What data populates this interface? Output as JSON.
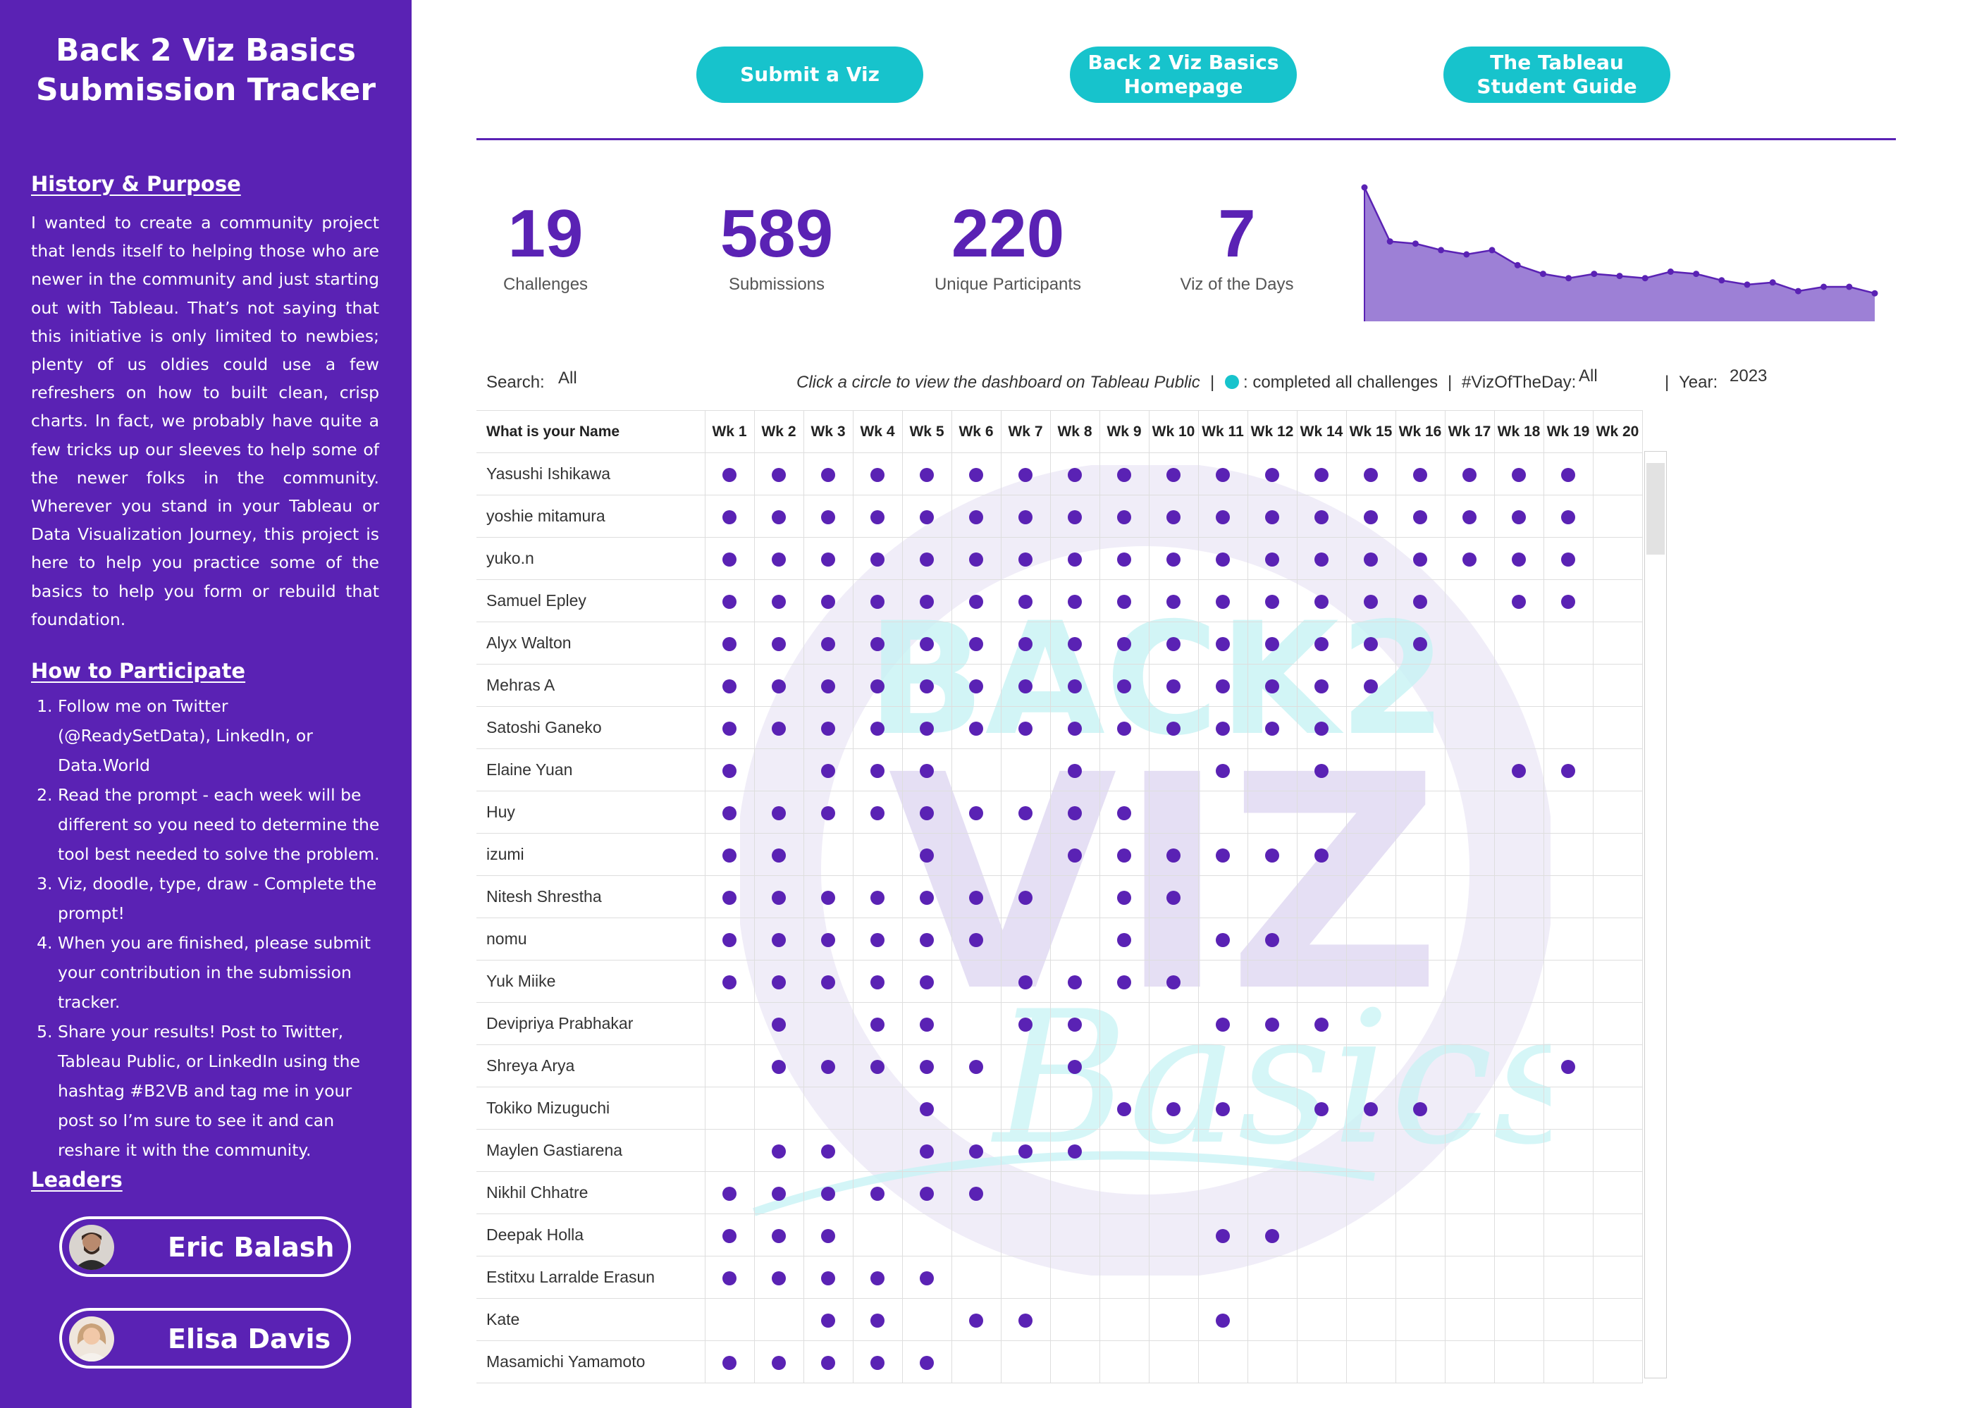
{
  "sidebar": {
    "title_line1": "Back 2 Viz Basics",
    "title_line2": "Submission Tracker",
    "history_heading": "History & Purpose",
    "history_text": "I wanted to create a community project that lends itself to helping those who are newer in the community and just starting out with Tableau. That’s not saying that this initiative is only limited to newbies; plenty of us oldies could use a few refreshers on how to built clean, crisp charts. In fact, we probably have quite a few tricks up our sleeves to help some of the newer folks in the community. Wherever you stand in your Tableau or Data Visualization Journey, this project is here to help you practice some of the basics to help you form or rebuild that foundation.",
    "participate_heading": "How to Participate",
    "steps": [
      "Follow me on Twitter (@ReadySetData), LinkedIn, or Data.World",
      "Read the prompt - each week will be different so you need to determine the tool best needed to solve the problem.",
      "Viz, doodle, type, draw - Complete the prompt!",
      "When you are finished, please submit your contribution in the submission tracker.",
      "Share your results! Post to Twitter, Tableau Public, or LinkedIn using the hashtag #B2VB and tag me in your post so I’m sure to see it and can reshare it with the community."
    ],
    "leaders_heading": "Leaders",
    "leaders": [
      "Eric Balash",
      "Elisa Davis"
    ]
  },
  "buttons": {
    "submit": "Submit a Viz",
    "homepage_line1": "Back 2 Viz Basics",
    "homepage_line2": "Homepage",
    "guide_line1": "The Tableau",
    "guide_line2": "Student Guide"
  },
  "kpis": {
    "challenges": {
      "value": "19",
      "label": "Challenges"
    },
    "submissions": {
      "value": "589",
      "label": "Submissions"
    },
    "participants": {
      "value": "220",
      "label": "Unique Participants"
    },
    "votd": {
      "value": "7",
      "label": "Viz of the Days"
    }
  },
  "sparkline": {
    "series_color": "#5a22b4",
    "fill_color": "#9d80d6",
    "values": [
      62,
      37,
      36,
      33,
      31,
      33,
      26,
      22,
      20,
      22,
      21,
      20,
      23,
      22,
      19,
      17,
      18,
      14,
      16,
      16,
      13
    ]
  },
  "filters": {
    "search_label": "Search:",
    "search_value": "All",
    "instruction": "Click a circle to view the dashboard on Tableau Public",
    "sep1": "|",
    "legend_text": ": completed all challenges",
    "sep2": "|",
    "votd_label": "#VizOfTheDay:",
    "votd_value": "All",
    "sep3": "|",
    "year_label": "Year:",
    "year_value": "2023",
    "legend_color": "#17c3cc"
  },
  "table": {
    "name_header": "What is your Name",
    "weeks": [
      "Wk 1",
      "Wk 2",
      "Wk 3",
      "Wk 4",
      "Wk 5",
      "Wk 6",
      "Wk 7",
      "Wk 8",
      "Wk 9",
      "Wk 10",
      "Wk 11",
      "Wk 12",
      "Wk 14",
      "Wk 15",
      "Wk 16",
      "Wk 17",
      "Wk 18",
      "Wk 19",
      "Wk 20"
    ],
    "rows": [
      {
        "name": "Yasushi Ishikawa",
        "marks": [
          1,
          1,
          1,
          1,
          1,
          1,
          1,
          1,
          1,
          1,
          1,
          1,
          1,
          1,
          1,
          1,
          1,
          1,
          0
        ]
      },
      {
        "name": "yoshie mitamura",
        "marks": [
          1,
          1,
          1,
          1,
          1,
          1,
          1,
          1,
          1,
          1,
          1,
          1,
          1,
          1,
          1,
          1,
          1,
          1,
          0
        ]
      },
      {
        "name": "yuko.n",
        "marks": [
          1,
          1,
          1,
          1,
          1,
          1,
          1,
          1,
          1,
          1,
          1,
          1,
          1,
          1,
          1,
          1,
          1,
          1,
          0
        ]
      },
      {
        "name": "Samuel Epley",
        "marks": [
          1,
          1,
          1,
          1,
          1,
          1,
          1,
          1,
          1,
          1,
          1,
          1,
          1,
          1,
          1,
          0,
          1,
          1,
          0
        ]
      },
      {
        "name": "Alyx Walton",
        "marks": [
          1,
          1,
          1,
          1,
          1,
          1,
          1,
          1,
          1,
          1,
          1,
          1,
          1,
          1,
          1,
          0,
          0,
          0,
          0
        ]
      },
      {
        "name": "Mehras A",
        "marks": [
          1,
          1,
          1,
          1,
          1,
          1,
          1,
          1,
          1,
          1,
          1,
          1,
          1,
          1,
          0,
          0,
          0,
          0,
          0
        ]
      },
      {
        "name": "Satoshi Ganeko",
        "marks": [
          1,
          1,
          1,
          1,
          1,
          1,
          1,
          1,
          1,
          1,
          1,
          1,
          1,
          0,
          0,
          0,
          0,
          0,
          0
        ]
      },
      {
        "name": "Elaine Yuan",
        "marks": [
          1,
          0,
          1,
          1,
          1,
          0,
          0,
          1,
          0,
          0,
          1,
          0,
          1,
          0,
          0,
          0,
          1,
          1,
          0
        ]
      },
      {
        "name": "Huy",
        "marks": [
          1,
          1,
          1,
          1,
          1,
          1,
          1,
          1,
          1,
          0,
          0,
          0,
          0,
          0,
          0,
          0,
          0,
          0,
          0
        ]
      },
      {
        "name": "izumi",
        "marks": [
          1,
          1,
          0,
          0,
          1,
          0,
          0,
          1,
          1,
          1,
          1,
          1,
          1,
          0,
          0,
          0,
          0,
          0,
          0
        ]
      },
      {
        "name": "Nitesh Shrestha",
        "marks": [
          1,
          1,
          1,
          1,
          1,
          1,
          1,
          0,
          1,
          1,
          0,
          0,
          0,
          0,
          0,
          0,
          0,
          0,
          0
        ]
      },
      {
        "name": "nomu",
        "marks": [
          1,
          1,
          1,
          1,
          1,
          1,
          0,
          0,
          1,
          0,
          1,
          1,
          0,
          0,
          0,
          0,
          0,
          0,
          0
        ]
      },
      {
        "name": "Yuk Miike",
        "marks": [
          1,
          1,
          1,
          1,
          1,
          0,
          1,
          1,
          1,
          1,
          0,
          0,
          0,
          0,
          0,
          0,
          0,
          0,
          0
        ]
      },
      {
        "name": "Devipriya Prabhakar",
        "marks": [
          0,
          1,
          0,
          1,
          1,
          0,
          1,
          1,
          0,
          0,
          1,
          1,
          1,
          0,
          0,
          0,
          0,
          0,
          0
        ]
      },
      {
        "name": "Shreya Arya",
        "marks": [
          0,
          1,
          1,
          1,
          1,
          1,
          0,
          1,
          0,
          0,
          0,
          0,
          0,
          0,
          0,
          0,
          0,
          1,
          0
        ]
      },
      {
        "name": "Tokiko Mizuguchi",
        "marks": [
          0,
          0,
          0,
          0,
          1,
          0,
          0,
          0,
          1,
          1,
          1,
          0,
          1,
          1,
          1,
          0,
          0,
          0,
          0
        ]
      },
      {
        "name": "Maylen Gastiarena",
        "marks": [
          0,
          1,
          1,
          0,
          1,
          1,
          1,
          1,
          0,
          0,
          0,
          0,
          0,
          0,
          0,
          0,
          0,
          0,
          0
        ]
      },
      {
        "name": "Nikhil Chhatre",
        "marks": [
          1,
          1,
          1,
          1,
          1,
          1,
          0,
          0,
          0,
          0,
          0,
          0,
          0,
          0,
          0,
          0,
          0,
          0,
          0
        ]
      },
      {
        "name": "Deepak Holla",
        "marks": [
          1,
          1,
          1,
          0,
          0,
          0,
          0,
          0,
          0,
          0,
          1,
          1,
          0,
          0,
          0,
          0,
          0,
          0,
          0
        ]
      },
      {
        "name": "Estitxu Larralde Erasun",
        "marks": [
          1,
          1,
          1,
          1,
          1,
          0,
          0,
          0,
          0,
          0,
          0,
          0,
          0,
          0,
          0,
          0,
          0,
          0,
          0
        ]
      },
      {
        "name": "Kate",
        "marks": [
          0,
          0,
          1,
          1,
          0,
          1,
          1,
          0,
          0,
          0,
          1,
          0,
          0,
          0,
          0,
          0,
          0,
          0,
          0
        ]
      },
      {
        "name": "Masamichi Yamamoto",
        "marks": [
          1,
          1,
          1,
          1,
          1,
          0,
          0,
          0,
          0,
          0,
          0,
          0,
          0,
          0,
          0,
          0,
          0,
          0,
          0
        ]
      }
    ]
  },
  "watermark": {
    "line1": "BACK2",
    "line2": "VIZ",
    "line3": "Basics"
  },
  "colors": {
    "accent_purple": "#5a22b4",
    "accent_teal": "#17c3cc"
  }
}
